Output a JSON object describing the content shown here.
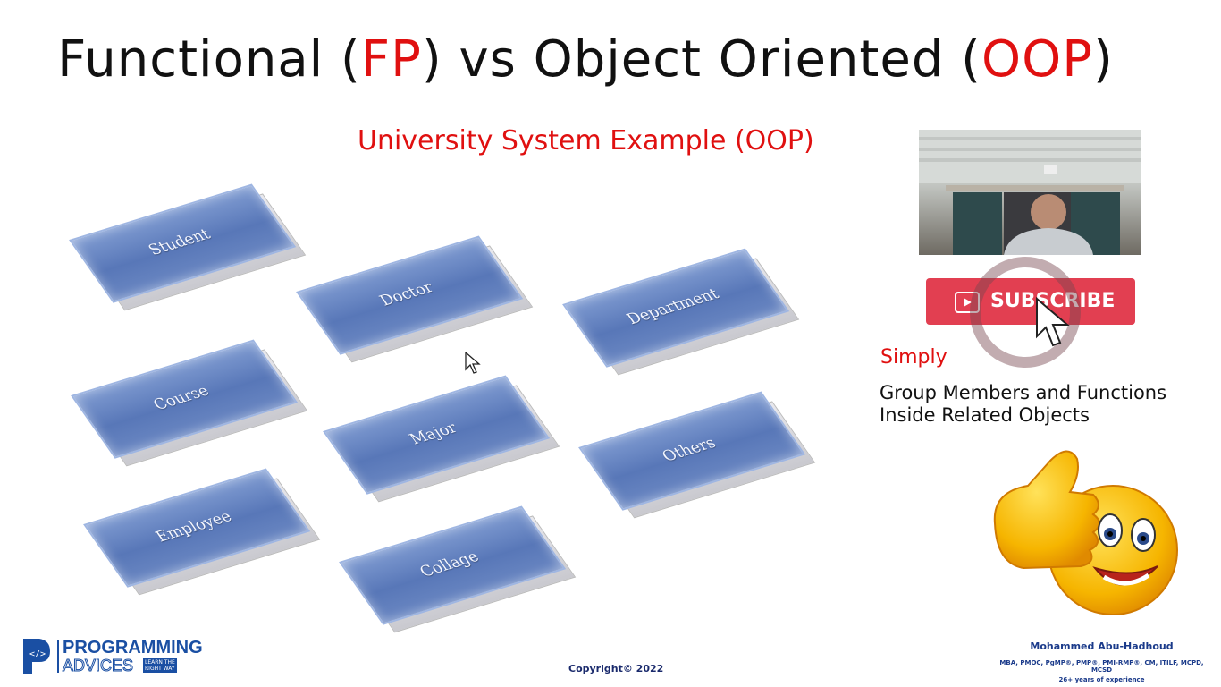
{
  "title": {
    "part1": "Functional (",
    "fp": "FP",
    "part2": ") vs Object Oriented (",
    "oop": "OOP",
    "part3": ")"
  },
  "subtitle": "University System Example (OOP)",
  "tiles": [
    {
      "label": "Student"
    },
    {
      "label": "Doctor"
    },
    {
      "label": "Department"
    },
    {
      "label": "Course"
    },
    {
      "label": "Major"
    },
    {
      "label": "Others"
    },
    {
      "label": "Employee"
    },
    {
      "label": "Collage"
    }
  ],
  "subscribe": {
    "label": "SUBSCRIBE"
  },
  "simply": "Simply",
  "description": {
    "line1": "Group Members and Functions",
    "line2": "Inside Related Objects"
  },
  "logo": {
    "line1": "PROGRAMMING",
    "line2": "ADVICES",
    "tag1": "LEARN THE",
    "tag2": "RIGHT WAY"
  },
  "copyright": "Copyright© 2022",
  "author": {
    "name": "Mohammed Abu-Hadhoud",
    "certs": "MBA, PMOC, PgMP®, PMP®, PMI-RMP®, CM, ITILF, MCPD, MCSD",
    "experience": "26+ years of experience"
  },
  "colors": {
    "accent": "#e01010",
    "tile": "#5877b8",
    "subscribe": "#e23f51",
    "brand": "#1a3a8a"
  }
}
